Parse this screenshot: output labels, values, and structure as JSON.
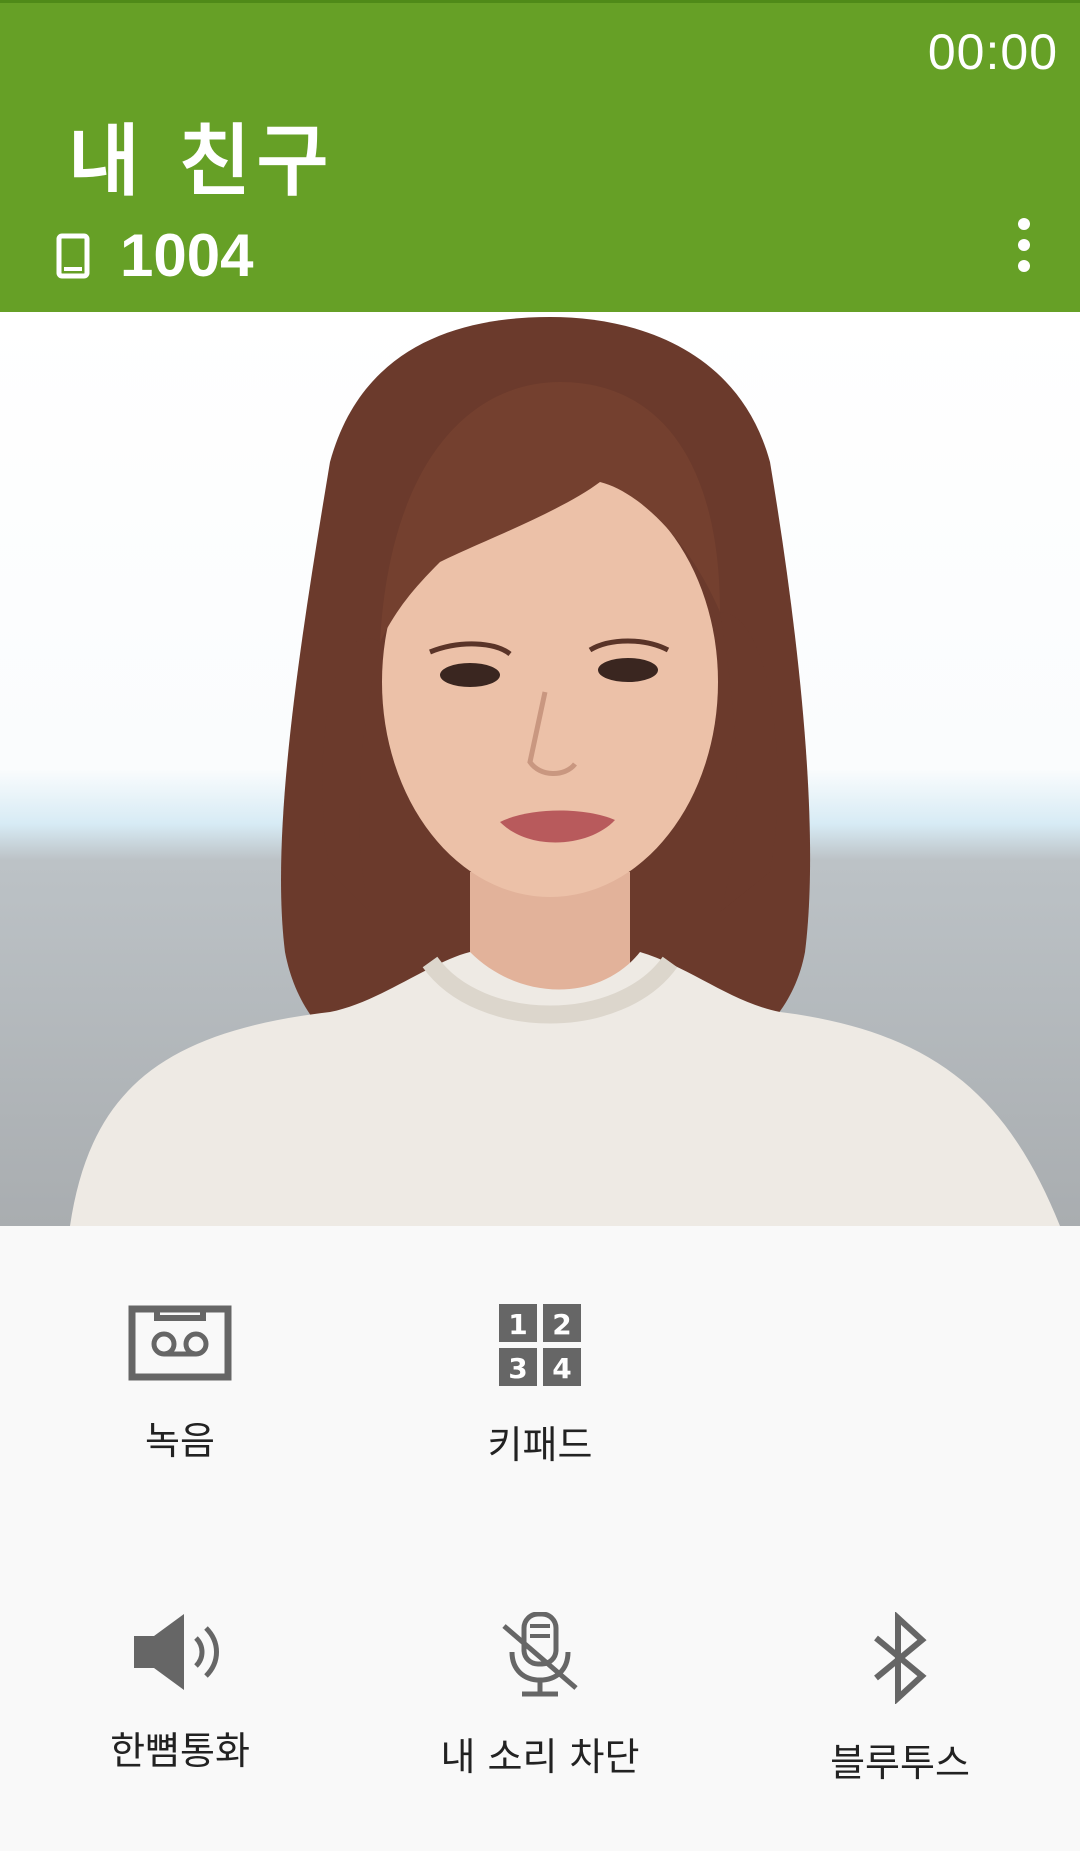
{
  "call": {
    "timer": "00:00",
    "contact_name": "내 친구",
    "number": "1004",
    "phone_icon": "mobile-phone-icon",
    "more_icon": "more-vertical-icon"
  },
  "photo": {
    "icon": "contact-photo"
  },
  "controls": [
    {
      "id": "record",
      "label": "녹음",
      "icon": "voicemail-tape-icon"
    },
    {
      "id": "keypad",
      "label": "키패드",
      "icon": "keypad-grid-icon"
    },
    {
      "id": "speaker",
      "label": "한뼘통화",
      "icon": "speaker-icon"
    },
    {
      "id": "mute",
      "label": "내 소리 차단",
      "icon": "mic-off-icon"
    },
    {
      "id": "bluetooth",
      "label": "블루투스",
      "icon": "bluetooth-icon"
    }
  ],
  "colors": {
    "header": "#66a026",
    "icon": "#666666"
  }
}
